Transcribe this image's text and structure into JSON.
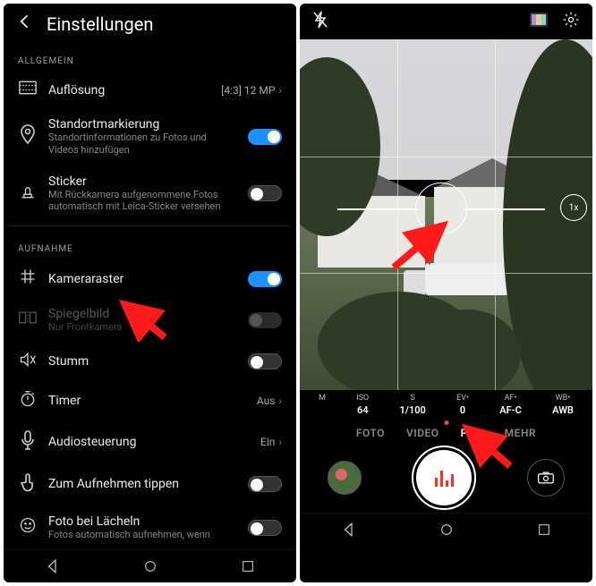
{
  "settings": {
    "title": "Einstellungen",
    "section_general": "ALLGEMEIN",
    "section_capture": "AUFNAHME",
    "rows": {
      "resolution": {
        "title": "Auflösung",
        "value": "[4:3] 12 MP"
      },
      "geotag": {
        "title": "Standortmarkierung",
        "sub": "Standortinformationen zu Fotos und Videos hinzufügen"
      },
      "sticker": {
        "title": "Sticker",
        "sub": "Mit Rückkamera aufgenommene Fotos automatisch mit Leica-Sticker versehen"
      },
      "grid": {
        "title": "Kameraraster"
      },
      "mirror": {
        "title": "Spiegelbild",
        "sub": "Nur Frontkamera"
      },
      "mute": {
        "title": "Stumm"
      },
      "timer": {
        "title": "Timer",
        "value": "Aus"
      },
      "audio": {
        "title": "Audiosteuerung",
        "value": "Ein"
      },
      "tap": {
        "title": "Zum Aufnehmen tippen"
      },
      "smile": {
        "title": "Foto bei Lächeln",
        "sub": "Fotos automatisch aufnehmen, wenn"
      }
    }
  },
  "camera": {
    "zoom": "1x",
    "params": {
      "m": {
        "label": "M",
        "value": ""
      },
      "iso": {
        "label": "ISO",
        "value": "64"
      },
      "s": {
        "label": "S",
        "value": "1/100"
      },
      "ev": {
        "label": "EV•",
        "value": "0"
      },
      "af": {
        "label": "AF•",
        "value": "AF-C"
      },
      "wb": {
        "label": "WB•",
        "value": "AWB"
      }
    },
    "modes": {
      "foto": "FOTO",
      "video": "VIDEO",
      "pro": "PRO",
      "mehr": "MEHR"
    }
  }
}
